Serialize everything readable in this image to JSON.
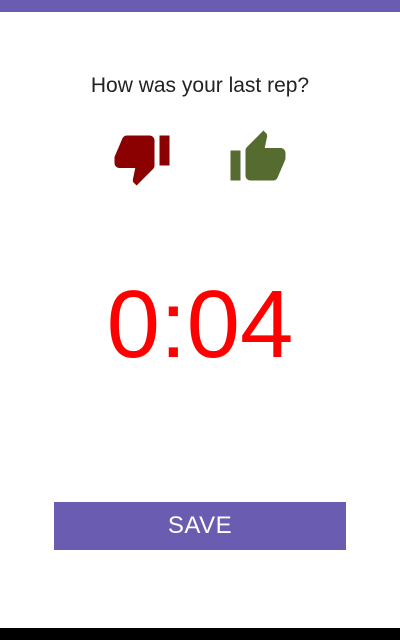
{
  "prompt": {
    "question": "How was your last rep?"
  },
  "rating": {
    "thumbs_down_icon": "thumbs-down-icon",
    "thumbs_down_color": "#8b0000",
    "thumbs_up_icon": "thumbs-up-icon",
    "thumbs_up_color": "#556b2f"
  },
  "timer": {
    "value": "0:04",
    "color": "#ff0000"
  },
  "actions": {
    "save_label": "SAVE",
    "accent_color": "#6a5cb0"
  }
}
